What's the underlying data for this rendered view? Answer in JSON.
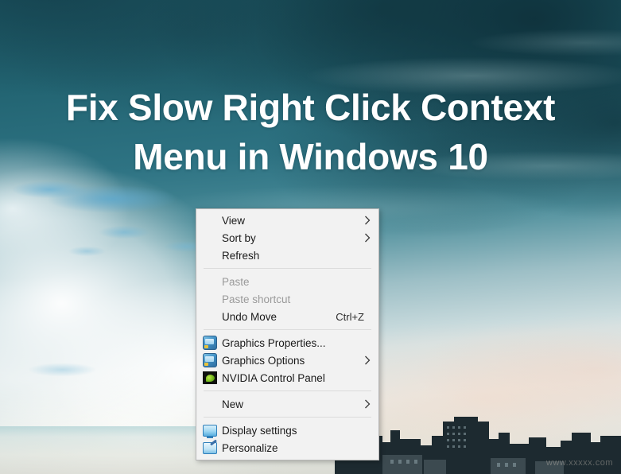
{
  "page": {
    "title_text": "Fix Slow Right Click Context\nMenu in Windows 10",
    "watermark": "www.xxxxx.com",
    "accent_color": "#2e7383",
    "menu_bg": "#f2f2f2",
    "title_color": "#ffffff"
  },
  "context_menu": {
    "groups": [
      {
        "items": [
          {
            "label": "View",
            "icon": "none",
            "accel": "",
            "submenu": true,
            "disabled": false
          },
          {
            "label": "Sort by",
            "icon": "none",
            "accel": "",
            "submenu": true,
            "disabled": false
          },
          {
            "label": "Refresh",
            "icon": "none",
            "accel": "",
            "submenu": false,
            "disabled": false
          }
        ]
      },
      {
        "items": [
          {
            "label": "Paste",
            "icon": "none",
            "accel": "",
            "submenu": false,
            "disabled": true
          },
          {
            "label": "Paste shortcut",
            "icon": "none",
            "accel": "",
            "submenu": false,
            "disabled": true
          },
          {
            "label": "Undo Move",
            "icon": "none",
            "accel": "Ctrl+Z",
            "submenu": false,
            "disabled": false
          }
        ]
      },
      {
        "items": [
          {
            "label": "Graphics Properties...",
            "icon": "graphics-icon",
            "accel": "",
            "submenu": false,
            "disabled": false
          },
          {
            "label": "Graphics Options",
            "icon": "graphics-icon",
            "accel": "",
            "submenu": true,
            "disabled": false
          },
          {
            "label": "NVIDIA Control Panel",
            "icon": "nvidia-icon",
            "accel": "",
            "submenu": false,
            "disabled": false
          }
        ]
      },
      {
        "items": [
          {
            "label": "New",
            "icon": "none",
            "accel": "",
            "submenu": true,
            "disabled": false
          }
        ]
      },
      {
        "items": [
          {
            "label": "Display settings",
            "icon": "monitor-icon",
            "accel": "",
            "submenu": false,
            "disabled": false
          },
          {
            "label": "Personalize",
            "icon": "paintbrush-monitor-icon",
            "accel": "",
            "submenu": false,
            "disabled": false
          }
        ]
      }
    ]
  }
}
